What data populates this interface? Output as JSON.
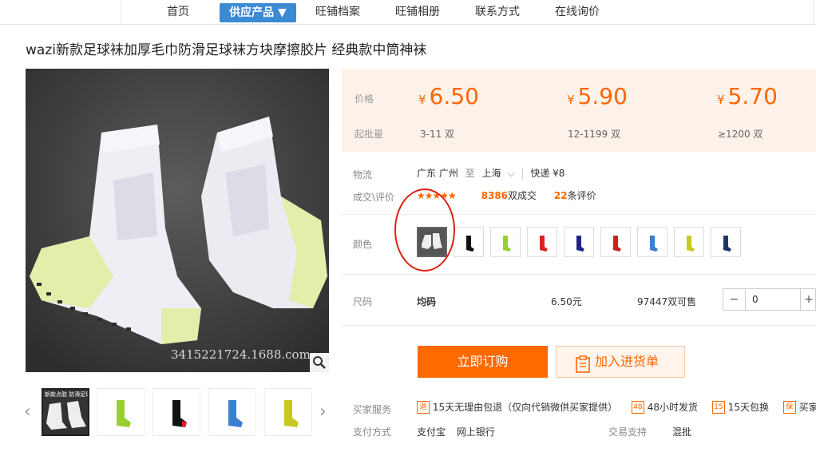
{
  "nav": {
    "items": [
      "首页",
      "供应产品 ▼",
      "旺铺档案",
      "旺铺相册",
      "联系方式",
      "在线询价"
    ]
  },
  "product": {
    "title": "wazi新款足球袜加厚毛巾防滑足球袜方块摩擦胶片 经典款中筒神袜",
    "watermark": "3415221724.1688.com",
    "thumb_caption": "新款点胶 防滑足球袜"
  },
  "prices": {
    "price_label": "价格",
    "minqty_label": "起批量",
    "tiers": [
      {
        "currency": "¥",
        "price": "6.50",
        "qty": "3-11 双"
      },
      {
        "currency": "¥",
        "price": "5.90",
        "qty": "12-1199 双"
      },
      {
        "currency": "¥",
        "price": "5.70",
        "qty": "≥1200 双"
      }
    ]
  },
  "logistics": {
    "label": "物流",
    "from": "广东 广州",
    "to_word": "至",
    "to": "上海",
    "method": "快递 ¥8"
  },
  "deals": {
    "label": "成交\\评价",
    "stars": "★★★★★",
    "deal_count": "8386",
    "deal_suffix": "双成交",
    "review_count": "22",
    "review_suffix": "条评价"
  },
  "color": {
    "label": "颜色",
    "swatch_colors": [
      "#222222",
      "#111111",
      "#9acd32",
      "#dd2222",
      "#22228c",
      "#cc2222",
      "#3a7fd0",
      "#c8c820",
      "#223366"
    ]
  },
  "size": {
    "label": "尺码",
    "value": "均码",
    "price": "6.50元",
    "stock": "97447双可售",
    "quantity": "0",
    "minus": "−",
    "plus": "+"
  },
  "actions": {
    "order": "立即订购",
    "cart": "加入进货单"
  },
  "service": {
    "label": "买家服务",
    "badges": [
      {
        "icon": "退",
        "text": "15天无理由包退（仅向代销微供买家提供）"
      },
      {
        "icon": "48",
        "text": "48小时发货"
      },
      {
        "icon": "15",
        "text": "15天包换"
      },
      {
        "icon": "保",
        "text": "买家"
      }
    ]
  },
  "payment": {
    "label": "支付方式",
    "methods": [
      "支付宝",
      "网上银行"
    ],
    "trade_label": "交易支持",
    "trade_value": "混批"
  },
  "colors": {
    "accent": "#ff6600",
    "nav_active": "#3a8ad4",
    "price_bg": "#fdf2e9",
    "annotation": "#dd1111"
  }
}
